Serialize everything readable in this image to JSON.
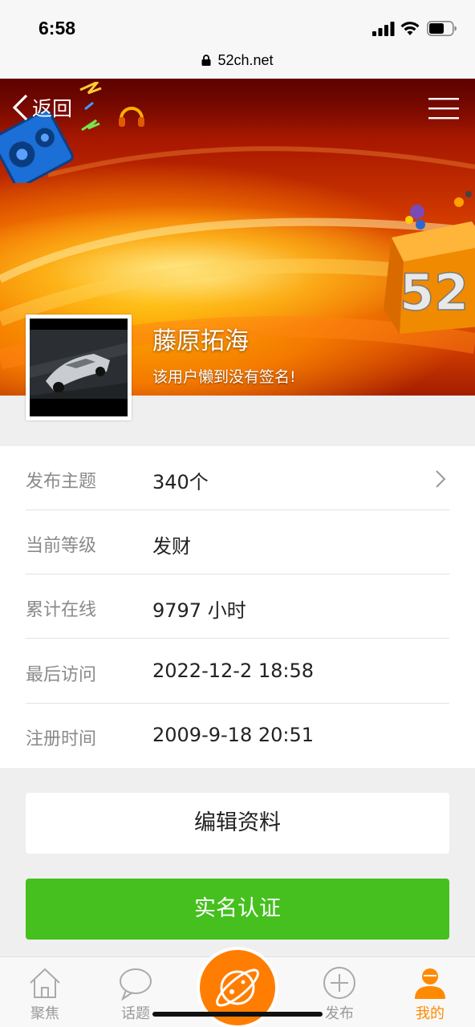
{
  "status_bar": {
    "time": "6:58",
    "url": "52ch.net"
  },
  "header": {
    "back_label": "返回"
  },
  "banner": {
    "cube_text": "52"
  },
  "profile": {
    "username": "藤原拓海",
    "signature": "该用户懒到没有签名!"
  },
  "info_rows": [
    {
      "label": "发布主题",
      "value": "340个"
    },
    {
      "label": "当前等级",
      "value": "发财"
    },
    {
      "label": "累计在线",
      "value": "9797 小时"
    },
    {
      "label": "最后访问",
      "value": "2022-12-2 18:58"
    },
    {
      "label": "注册时间",
      "value": "2009-9-18 20:51"
    }
  ],
  "buttons": {
    "edit": "编辑资料",
    "verify": "实名认证"
  },
  "tabbar": {
    "items": [
      {
        "label": "聚焦",
        "icon": "home-icon"
      },
      {
        "label": "话题",
        "icon": "chat-bubble-icon"
      },
      {
        "label": "发布",
        "icon": "plus-circle-icon"
      },
      {
        "label": "我的",
        "icon": "user-icon"
      }
    ]
  },
  "colors": {
    "accent": "#ff7d00",
    "verify_green": "#45c01e"
  }
}
